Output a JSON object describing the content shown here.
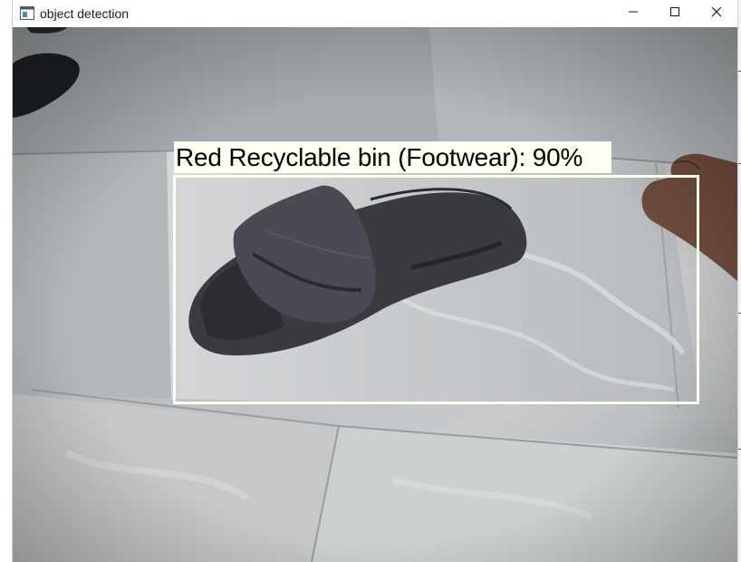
{
  "window": {
    "title": "object detection",
    "app_icon": "app-window-icon",
    "controls": {
      "minimize_icon": "minimize-icon",
      "maximize_icon": "maximize-icon",
      "close_icon": "close-icon"
    }
  },
  "detection": {
    "label": "Red Recyclable bin (Footwear): 90%",
    "box_color": "#fffff0",
    "label_bg_color": "#fffff2"
  }
}
